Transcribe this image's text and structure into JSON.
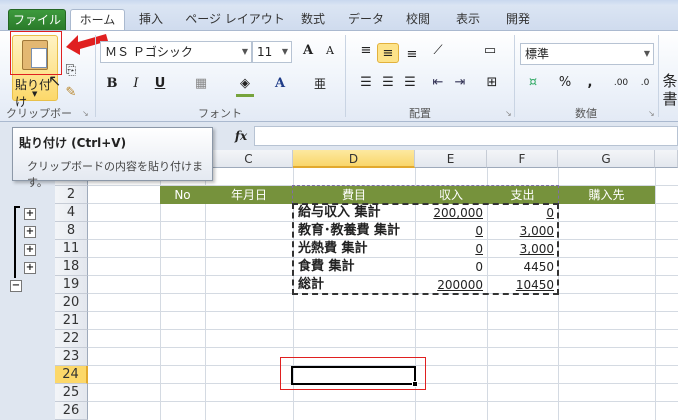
{
  "ribbon_tabs": [
    "ファイル",
    "ホーム",
    "挿入",
    "ページ レイアウト",
    "数式",
    "データ",
    "校閲",
    "表示",
    "開発"
  ],
  "clipboard": {
    "paste_label": "貼り付け",
    "group_label": "クリップボード"
  },
  "font": {
    "name": "ＭＳ Ｐゴシック",
    "size": "11",
    "group_label": "フォント",
    "bold": "B",
    "italic": "I",
    "underline": "U",
    "font_color": "A",
    "grow": "A",
    "shrink": "A",
    "phonetic": "亜"
  },
  "alignment": {
    "group_label": "配置"
  },
  "number": {
    "format": "標準",
    "group_label": "数値",
    "percent": "%",
    "comma": ",",
    "inc_decimal": ".00",
    "dec_decimal": ".0"
  },
  "styles": {
    "partial_label": "条",
    "partial_label2": "書"
  },
  "formula_bar": {
    "fx": "fx",
    "value": ""
  },
  "tooltip": {
    "title": "貼り付け (Ctrl+V)",
    "description": "クリップボードの内容を貼り付けます。"
  },
  "columns": [
    "C",
    "D",
    "E",
    "F",
    "G"
  ],
  "rows": [
    "2",
    "4",
    "8",
    "11",
    "18",
    "19",
    "20",
    "21",
    "22",
    "23",
    "24",
    "25",
    "26"
  ],
  "header_row": [
    "No",
    "年月日",
    "費目",
    "収入",
    "支出",
    "購入先"
  ],
  "data_rows": [
    {
      "item": "給与収入 集計",
      "income": "200,000",
      "expense": "0"
    },
    {
      "item": "教育･教養費 集計",
      "income": "0",
      "expense": "3,000"
    },
    {
      "item": "光熱費 集計",
      "income": "0",
      "expense": "3,000"
    },
    {
      "item": "食費 集計",
      "income": "0",
      "expense": "4450"
    },
    {
      "item": "総計",
      "income": "200000",
      "expense": "10450"
    }
  ],
  "outline": {
    "expand": "+",
    "collapse": "−"
  },
  "colors": {
    "header_green": "#76923c",
    "file_tab": "#2a7a2a",
    "selected_header": "#fcd86a",
    "annotation_red": "#e02020"
  }
}
